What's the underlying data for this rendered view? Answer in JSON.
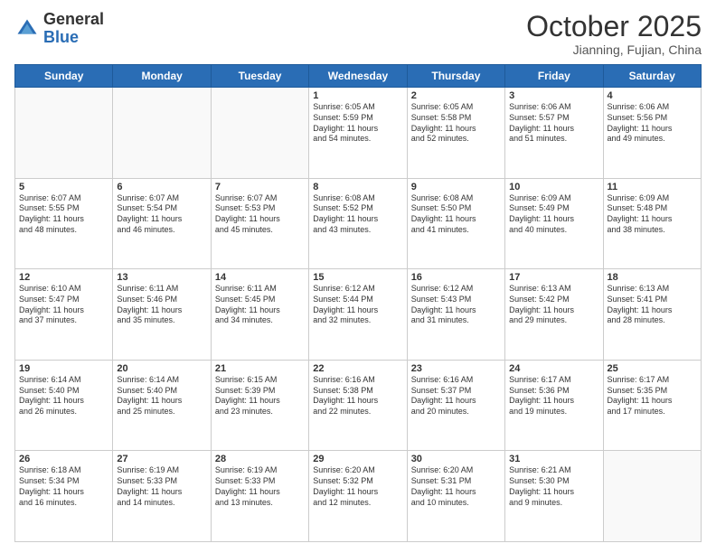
{
  "logo": {
    "general": "General",
    "blue": "Blue"
  },
  "header": {
    "month": "October 2025",
    "location": "Jianning, Fujian, China"
  },
  "days_of_week": [
    "Sunday",
    "Monday",
    "Tuesday",
    "Wednesday",
    "Thursday",
    "Friday",
    "Saturday"
  ],
  "weeks": [
    [
      {
        "day": "",
        "info": ""
      },
      {
        "day": "",
        "info": ""
      },
      {
        "day": "",
        "info": ""
      },
      {
        "day": "1",
        "info": "Sunrise: 6:05 AM\nSunset: 5:59 PM\nDaylight: 11 hours\nand 54 minutes."
      },
      {
        "day": "2",
        "info": "Sunrise: 6:05 AM\nSunset: 5:58 PM\nDaylight: 11 hours\nand 52 minutes."
      },
      {
        "day": "3",
        "info": "Sunrise: 6:06 AM\nSunset: 5:57 PM\nDaylight: 11 hours\nand 51 minutes."
      },
      {
        "day": "4",
        "info": "Sunrise: 6:06 AM\nSunset: 5:56 PM\nDaylight: 11 hours\nand 49 minutes."
      }
    ],
    [
      {
        "day": "5",
        "info": "Sunrise: 6:07 AM\nSunset: 5:55 PM\nDaylight: 11 hours\nand 48 minutes."
      },
      {
        "day": "6",
        "info": "Sunrise: 6:07 AM\nSunset: 5:54 PM\nDaylight: 11 hours\nand 46 minutes."
      },
      {
        "day": "7",
        "info": "Sunrise: 6:07 AM\nSunset: 5:53 PM\nDaylight: 11 hours\nand 45 minutes."
      },
      {
        "day": "8",
        "info": "Sunrise: 6:08 AM\nSunset: 5:52 PM\nDaylight: 11 hours\nand 43 minutes."
      },
      {
        "day": "9",
        "info": "Sunrise: 6:08 AM\nSunset: 5:50 PM\nDaylight: 11 hours\nand 41 minutes."
      },
      {
        "day": "10",
        "info": "Sunrise: 6:09 AM\nSunset: 5:49 PM\nDaylight: 11 hours\nand 40 minutes."
      },
      {
        "day": "11",
        "info": "Sunrise: 6:09 AM\nSunset: 5:48 PM\nDaylight: 11 hours\nand 38 minutes."
      }
    ],
    [
      {
        "day": "12",
        "info": "Sunrise: 6:10 AM\nSunset: 5:47 PM\nDaylight: 11 hours\nand 37 minutes."
      },
      {
        "day": "13",
        "info": "Sunrise: 6:11 AM\nSunset: 5:46 PM\nDaylight: 11 hours\nand 35 minutes."
      },
      {
        "day": "14",
        "info": "Sunrise: 6:11 AM\nSunset: 5:45 PM\nDaylight: 11 hours\nand 34 minutes."
      },
      {
        "day": "15",
        "info": "Sunrise: 6:12 AM\nSunset: 5:44 PM\nDaylight: 11 hours\nand 32 minutes."
      },
      {
        "day": "16",
        "info": "Sunrise: 6:12 AM\nSunset: 5:43 PM\nDaylight: 11 hours\nand 31 minutes."
      },
      {
        "day": "17",
        "info": "Sunrise: 6:13 AM\nSunset: 5:42 PM\nDaylight: 11 hours\nand 29 minutes."
      },
      {
        "day": "18",
        "info": "Sunrise: 6:13 AM\nSunset: 5:41 PM\nDaylight: 11 hours\nand 28 minutes."
      }
    ],
    [
      {
        "day": "19",
        "info": "Sunrise: 6:14 AM\nSunset: 5:40 PM\nDaylight: 11 hours\nand 26 minutes."
      },
      {
        "day": "20",
        "info": "Sunrise: 6:14 AM\nSunset: 5:40 PM\nDaylight: 11 hours\nand 25 minutes."
      },
      {
        "day": "21",
        "info": "Sunrise: 6:15 AM\nSunset: 5:39 PM\nDaylight: 11 hours\nand 23 minutes."
      },
      {
        "day": "22",
        "info": "Sunrise: 6:16 AM\nSunset: 5:38 PM\nDaylight: 11 hours\nand 22 minutes."
      },
      {
        "day": "23",
        "info": "Sunrise: 6:16 AM\nSunset: 5:37 PM\nDaylight: 11 hours\nand 20 minutes."
      },
      {
        "day": "24",
        "info": "Sunrise: 6:17 AM\nSunset: 5:36 PM\nDaylight: 11 hours\nand 19 minutes."
      },
      {
        "day": "25",
        "info": "Sunrise: 6:17 AM\nSunset: 5:35 PM\nDaylight: 11 hours\nand 17 minutes."
      }
    ],
    [
      {
        "day": "26",
        "info": "Sunrise: 6:18 AM\nSunset: 5:34 PM\nDaylight: 11 hours\nand 16 minutes."
      },
      {
        "day": "27",
        "info": "Sunrise: 6:19 AM\nSunset: 5:33 PM\nDaylight: 11 hours\nand 14 minutes."
      },
      {
        "day": "28",
        "info": "Sunrise: 6:19 AM\nSunset: 5:33 PM\nDaylight: 11 hours\nand 13 minutes."
      },
      {
        "day": "29",
        "info": "Sunrise: 6:20 AM\nSunset: 5:32 PM\nDaylight: 11 hours\nand 12 minutes."
      },
      {
        "day": "30",
        "info": "Sunrise: 6:20 AM\nSunset: 5:31 PM\nDaylight: 11 hours\nand 10 minutes."
      },
      {
        "day": "31",
        "info": "Sunrise: 6:21 AM\nSunset: 5:30 PM\nDaylight: 11 hours\nand 9 minutes."
      },
      {
        "day": "",
        "info": ""
      }
    ]
  ]
}
